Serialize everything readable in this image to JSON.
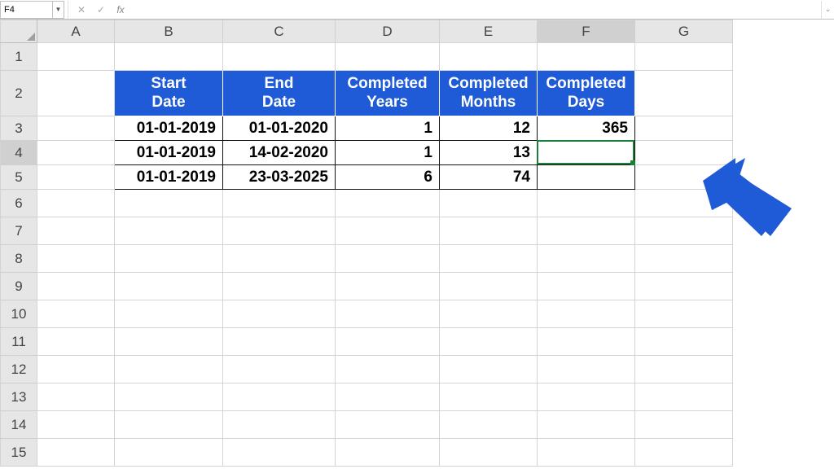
{
  "namebox": "F4",
  "fx_label": "fx",
  "cols": [
    "A",
    "B",
    "C",
    "D",
    "E",
    "F",
    "G"
  ],
  "rows": [
    "1",
    "2",
    "3",
    "4",
    "5",
    "6",
    "7",
    "8",
    "9",
    "10",
    "11",
    "12",
    "13",
    "14",
    "15"
  ],
  "active_col": "F",
  "active_row": "4",
  "headers": {
    "B": "Start\nDate",
    "C": "End\nDate",
    "D": "Completed\nYears",
    "E": "Completed\nMonths",
    "F": "Completed\nDays"
  },
  "data": [
    {
      "B": "01-01-2019",
      "C": "01-01-2020",
      "D": "1",
      "E": "12",
      "F": "365"
    },
    {
      "B": "01-01-2019",
      "C": "14-02-2020",
      "D": "1",
      "E": "13",
      "F": ""
    },
    {
      "B": "01-01-2019",
      "C": "23-03-2025",
      "D": "6",
      "E": "74",
      "F": ""
    }
  ],
  "colors": {
    "header_bg": "#1f5bd6",
    "arrow": "#1f5bd6",
    "selection": "#1a7f37"
  }
}
